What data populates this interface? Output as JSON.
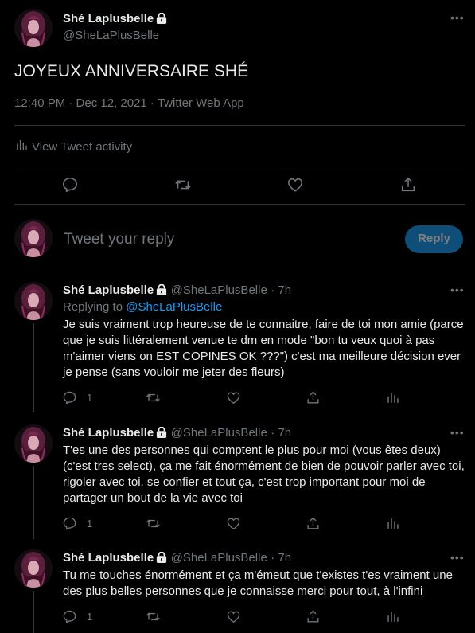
{
  "main_tweet": {
    "display_name": "Shé Laplusbelle",
    "handle": "@SheLaPlusBelle",
    "text": "JOYEUX ANNIVERSAIRE SHÉ",
    "meta": "12:40 PM · Dec 12, 2021 · Twitter Web App",
    "activity_label": "View Tweet activity"
  },
  "composer": {
    "placeholder": "Tweet your reply",
    "button_label": "Reply"
  },
  "replies": [
    {
      "display_name": "Shé Laplusbelle",
      "handle": "@SheLaPlusBelle",
      "time": "· 7h",
      "replying_to_label": "Replying to ",
      "replying_to_handle": "@SheLaPlusBelle",
      "text": "Je suis vraiment trop heureuse de te connaitre, faire de toi mon amie (parce que je suis littéralement venue te dm en mode \"bon tu veux quoi à pas m'aimer viens on EST COPINES OK ???\") c'est ma meilleure décision ever je pense (sans vouloir me jeter des fleurs)",
      "reply_count": "1"
    },
    {
      "display_name": "Shé Laplusbelle",
      "handle": "@SheLaPlusBelle",
      "time": "· 7h",
      "text": "T'es une des personnes qui comptent le plus pour moi (vous êtes deux) (c'est tres select), ça me fait énormément de bien de pouvoir parler avec toi, rigoler avec toi, se confier et tout ça, c'est trop important pour moi de partager un bout de la vie avec toi",
      "reply_count": "1"
    },
    {
      "display_name": "Shé Laplusbelle",
      "handle": "@SheLaPlusBelle",
      "time": "· 7h",
      "text": "Tu me touches énormément et ça m'émeut que t'existes t'es vraiment une des plus belles personnes que je connaisse merci pour tout, à l'infini",
      "reply_count": "1"
    }
  ],
  "icons": {
    "more": "more-icon",
    "lock": "lock-icon",
    "reply": "reply-icon",
    "retweet": "retweet-icon",
    "like": "like-icon",
    "share": "share-icon",
    "analytics": "analytics-icon"
  },
  "colors": {
    "background": "#000000",
    "text": "#e7e9ea",
    "muted": "#71767b",
    "accent": "#1d9bf0",
    "divider": "#2f3336"
  }
}
